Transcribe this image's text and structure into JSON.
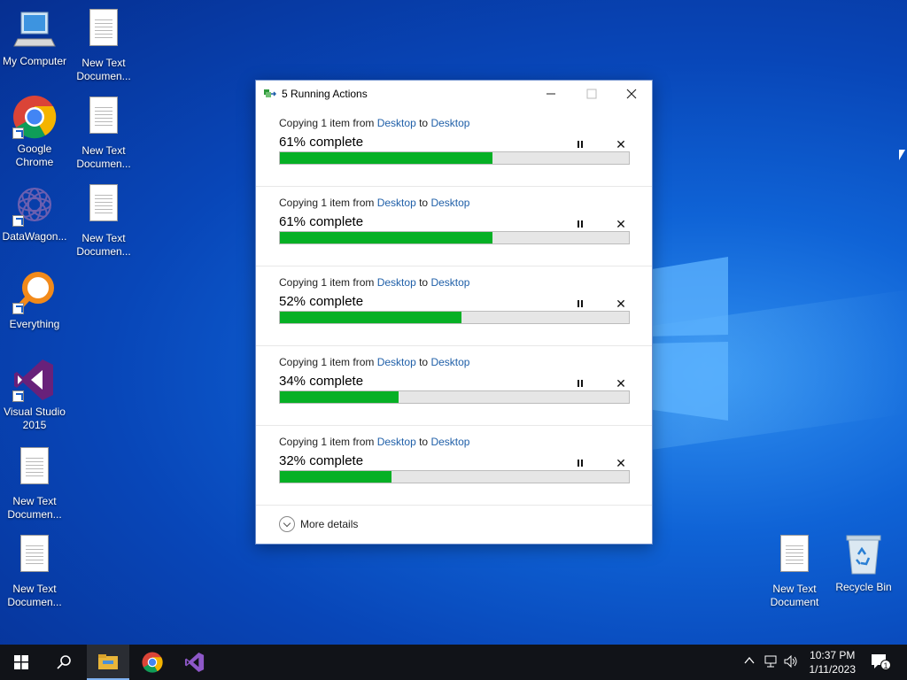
{
  "desktop": {
    "icons": [
      {
        "label": "My Computer",
        "icon": "computer-icon"
      },
      {
        "label": "New Text Documen...",
        "icon": "text-document-icon"
      },
      {
        "label": "Google Chrome",
        "icon": "chrome-icon"
      },
      {
        "label": "New Text Documen...",
        "icon": "text-document-icon"
      },
      {
        "label": "DataWagon...",
        "icon": "datawagon-icon"
      },
      {
        "label": "New Text Documen...",
        "icon": "text-document-icon"
      },
      {
        "label": "Everything",
        "icon": "everything-search-icon"
      },
      {
        "label": "Visual Studio 2015",
        "icon": "visual-studio-icon"
      },
      {
        "label": "New Text Documen...",
        "icon": "text-document-icon"
      },
      {
        "label": "New Text Documen...",
        "icon": "text-document-icon"
      },
      {
        "label": "New Text Document",
        "icon": "text-document-icon"
      },
      {
        "label": "Recycle Bin",
        "icon": "recycle-bin-icon"
      }
    ]
  },
  "dialog": {
    "title": "5 Running Actions",
    "icon": "copy-files-icon",
    "operations": [
      {
        "prefix": "Copying 1 item from",
        "source": "Desktop",
        "to": "to",
        "dest": "Desktop",
        "percent_text": "61% complete",
        "progress": 0.61
      },
      {
        "prefix": "Copying 1 item from",
        "source": "Desktop",
        "to": "to",
        "dest": "Desktop",
        "percent_text": "61% complete",
        "progress": 0.61
      },
      {
        "prefix": "Copying 1 item from",
        "source": "Desktop",
        "to": "to",
        "dest": "Desktop",
        "percent_text": "52% complete",
        "progress": 0.52
      },
      {
        "prefix": "Copying 1 item from",
        "source": "Desktop",
        "to": "to",
        "dest": "Desktop",
        "percent_text": "34% complete",
        "progress": 0.34
      },
      {
        "prefix": "Copying 1 item from",
        "source": "Desktop",
        "to": "to",
        "dest": "Desktop",
        "percent_text": "32% complete",
        "progress": 0.32
      }
    ],
    "more_details": "More details",
    "colors": {
      "progress": "#06b025",
      "link": "#1f5fa8"
    }
  },
  "taskbar": {
    "pinned": [
      "windows-start-icon",
      "search-icon",
      "file-explorer-icon",
      "chrome-icon",
      "visual-studio-icon"
    ],
    "time": "10:37 PM",
    "date": "1/11/2023",
    "notification_count": "1"
  }
}
